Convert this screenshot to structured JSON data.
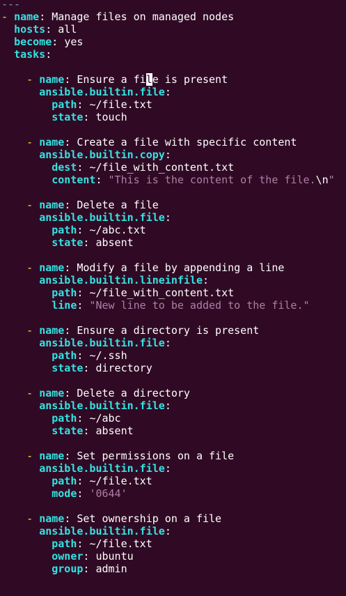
{
  "editor": {
    "lines": [
      [
        {
          "t": "---",
          "c": "d"
        }
      ],
      [
        {
          "t": "- ",
          "c": "dash"
        },
        {
          "t": "name",
          "c": "k"
        },
        {
          "t": ": ",
          "c": "c"
        },
        {
          "t": "Manage files on managed nodes",
          "c": "v"
        }
      ],
      [
        {
          "t": "  ",
          "c": "c"
        },
        {
          "t": "hosts",
          "c": "k"
        },
        {
          "t": ": ",
          "c": "c"
        },
        {
          "t": "all",
          "c": "v"
        }
      ],
      [
        {
          "t": "  ",
          "c": "c"
        },
        {
          "t": "become",
          "c": "k"
        },
        {
          "t": ": ",
          "c": "c"
        },
        {
          "t": "yes",
          "c": "v"
        }
      ],
      [
        {
          "t": "  ",
          "c": "c"
        },
        {
          "t": "tasks",
          "c": "k"
        },
        {
          "t": ":",
          "c": "c"
        }
      ],
      [],
      [
        {
          "t": "    - ",
          "c": "dash"
        },
        {
          "t": "name",
          "c": "k"
        },
        {
          "t": ": ",
          "c": "c"
        },
        {
          "t": "Ensure a fi",
          "c": "v"
        },
        {
          "t": "l",
          "c": "v",
          "cursor": true
        },
        {
          "t": "e is present",
          "c": "v"
        }
      ],
      [
        {
          "t": "      ",
          "c": "c"
        },
        {
          "t": "ansible.builtin.file",
          "c": "k"
        },
        {
          "t": ":",
          "c": "c"
        }
      ],
      [
        {
          "t": "        ",
          "c": "c"
        },
        {
          "t": "path",
          "c": "k"
        },
        {
          "t": ": ",
          "c": "c"
        },
        {
          "t": "~/file.txt",
          "c": "v"
        }
      ],
      [
        {
          "t": "        ",
          "c": "c"
        },
        {
          "t": "state",
          "c": "k"
        },
        {
          "t": ": ",
          "c": "c"
        },
        {
          "t": "touch",
          "c": "v"
        }
      ],
      [],
      [
        {
          "t": "    - ",
          "c": "dash"
        },
        {
          "t": "name",
          "c": "k"
        },
        {
          "t": ": ",
          "c": "c"
        },
        {
          "t": "Create a file with specific content",
          "c": "v"
        }
      ],
      [
        {
          "t": "      ",
          "c": "c"
        },
        {
          "t": "ansible.builtin.copy",
          "c": "k"
        },
        {
          "t": ":",
          "c": "c"
        }
      ],
      [
        {
          "t": "        ",
          "c": "c"
        },
        {
          "t": "dest",
          "c": "k"
        },
        {
          "t": ": ",
          "c": "c"
        },
        {
          "t": "~/file_with_content.txt",
          "c": "v"
        }
      ],
      [
        {
          "t": "        ",
          "c": "c"
        },
        {
          "t": "content",
          "c": "k"
        },
        {
          "t": ": ",
          "c": "c"
        },
        {
          "t": "\"This is the content of the file.",
          "c": "s"
        },
        {
          "t": "\\n",
          "c": "v"
        },
        {
          "t": "\"",
          "c": "s"
        }
      ],
      [],
      [
        {
          "t": "    - ",
          "c": "dash"
        },
        {
          "t": "name",
          "c": "k"
        },
        {
          "t": ": ",
          "c": "c"
        },
        {
          "t": "Delete a file",
          "c": "v"
        }
      ],
      [
        {
          "t": "      ",
          "c": "c"
        },
        {
          "t": "ansible.builtin.file",
          "c": "k"
        },
        {
          "t": ":",
          "c": "c"
        }
      ],
      [
        {
          "t": "        ",
          "c": "c"
        },
        {
          "t": "path",
          "c": "k"
        },
        {
          "t": ": ",
          "c": "c"
        },
        {
          "t": "~/abc.txt",
          "c": "v"
        }
      ],
      [
        {
          "t": "        ",
          "c": "c"
        },
        {
          "t": "state",
          "c": "k"
        },
        {
          "t": ": ",
          "c": "c"
        },
        {
          "t": "absent",
          "c": "v"
        }
      ],
      [],
      [
        {
          "t": "    - ",
          "c": "dash"
        },
        {
          "t": "name",
          "c": "k"
        },
        {
          "t": ": ",
          "c": "c"
        },
        {
          "t": "Modify a file by appending a line",
          "c": "v"
        }
      ],
      [
        {
          "t": "      ",
          "c": "c"
        },
        {
          "t": "ansible.builtin.lineinfile",
          "c": "k"
        },
        {
          "t": ":",
          "c": "c"
        }
      ],
      [
        {
          "t": "        ",
          "c": "c"
        },
        {
          "t": "path",
          "c": "k"
        },
        {
          "t": ": ",
          "c": "c"
        },
        {
          "t": "~/file_with_content.txt",
          "c": "v"
        }
      ],
      [
        {
          "t": "        ",
          "c": "c"
        },
        {
          "t": "line",
          "c": "k"
        },
        {
          "t": ": ",
          "c": "c"
        },
        {
          "t": "\"New line to be added to the file.\"",
          "c": "s"
        }
      ],
      [],
      [
        {
          "t": "    - ",
          "c": "dash"
        },
        {
          "t": "name",
          "c": "k"
        },
        {
          "t": ": ",
          "c": "c"
        },
        {
          "t": "Ensure a directory is present",
          "c": "v"
        }
      ],
      [
        {
          "t": "      ",
          "c": "c"
        },
        {
          "t": "ansible.builtin.file",
          "c": "k"
        },
        {
          "t": ":",
          "c": "c"
        }
      ],
      [
        {
          "t": "        ",
          "c": "c"
        },
        {
          "t": "path",
          "c": "k"
        },
        {
          "t": ": ",
          "c": "c"
        },
        {
          "t": "~/.ssh",
          "c": "v"
        }
      ],
      [
        {
          "t": "        ",
          "c": "c"
        },
        {
          "t": "state",
          "c": "k"
        },
        {
          "t": ": ",
          "c": "c"
        },
        {
          "t": "directory",
          "c": "v"
        }
      ],
      [],
      [
        {
          "t": "    - ",
          "c": "dash"
        },
        {
          "t": "name",
          "c": "k"
        },
        {
          "t": ": ",
          "c": "c"
        },
        {
          "t": "Delete a directory",
          "c": "v"
        }
      ],
      [
        {
          "t": "      ",
          "c": "c"
        },
        {
          "t": "ansible.builtin.file",
          "c": "k"
        },
        {
          "t": ":",
          "c": "c"
        }
      ],
      [
        {
          "t": "        ",
          "c": "c"
        },
        {
          "t": "path",
          "c": "k"
        },
        {
          "t": ": ",
          "c": "c"
        },
        {
          "t": "~/abc",
          "c": "v"
        }
      ],
      [
        {
          "t": "        ",
          "c": "c"
        },
        {
          "t": "state",
          "c": "k"
        },
        {
          "t": ": ",
          "c": "c"
        },
        {
          "t": "absent",
          "c": "v"
        }
      ],
      [],
      [
        {
          "t": "    - ",
          "c": "dash"
        },
        {
          "t": "name",
          "c": "k"
        },
        {
          "t": ": ",
          "c": "c"
        },
        {
          "t": "Set permissions on a file",
          "c": "v"
        }
      ],
      [
        {
          "t": "      ",
          "c": "c"
        },
        {
          "t": "ansible.builtin.file",
          "c": "k"
        },
        {
          "t": ":",
          "c": "c"
        }
      ],
      [
        {
          "t": "        ",
          "c": "c"
        },
        {
          "t": "path",
          "c": "k"
        },
        {
          "t": ": ",
          "c": "c"
        },
        {
          "t": "~/file.txt",
          "c": "v"
        }
      ],
      [
        {
          "t": "        ",
          "c": "c"
        },
        {
          "t": "mode",
          "c": "k"
        },
        {
          "t": ": ",
          "c": "c"
        },
        {
          "t": "'0644'",
          "c": "s"
        }
      ],
      [],
      [
        {
          "t": "    - ",
          "c": "dash"
        },
        {
          "t": "name",
          "c": "k"
        },
        {
          "t": ": ",
          "c": "c"
        },
        {
          "t": "Set ownership on a file",
          "c": "v"
        }
      ],
      [
        {
          "t": "      ",
          "c": "c"
        },
        {
          "t": "ansible.builtin.file",
          "c": "k"
        },
        {
          "t": ":",
          "c": "c"
        }
      ],
      [
        {
          "t": "        ",
          "c": "c"
        },
        {
          "t": "path",
          "c": "k"
        },
        {
          "t": ": ",
          "c": "c"
        },
        {
          "t": "~/file.txt",
          "c": "v"
        }
      ],
      [
        {
          "t": "        ",
          "c": "c"
        },
        {
          "t": "owner",
          "c": "k"
        },
        {
          "t": ": ",
          "c": "c"
        },
        {
          "t": "ubuntu",
          "c": "v"
        }
      ],
      [
        {
          "t": "        ",
          "c": "c"
        },
        {
          "t": "group",
          "c": "k"
        },
        {
          "t": ": ",
          "c": "c"
        },
        {
          "t": "admin",
          "c": "v"
        }
      ]
    ]
  },
  "colors": {
    "background": "#300a24",
    "key": "#34e2e2",
    "string": "#ad7fa8",
    "dash": "#fce94f",
    "doc_marker": "#729fcf"
  }
}
